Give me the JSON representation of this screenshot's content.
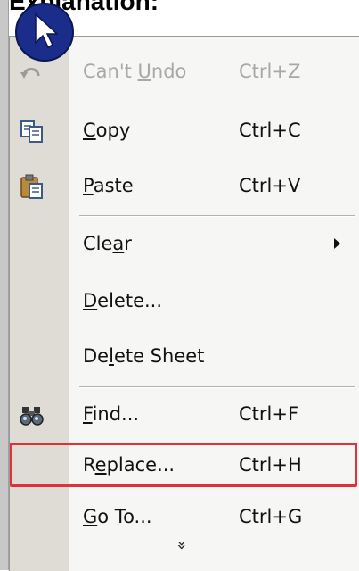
{
  "caption": "Explanation:",
  "menu": {
    "items": [
      {
        "label_pre": "Can't ",
        "label_u": "U",
        "label_post": "ndo",
        "shortcut": "Ctrl+Z",
        "disabled": true,
        "icon": "undo-icon"
      },
      {
        "label_pre": "",
        "label_u": "C",
        "label_post": "opy",
        "shortcut": "Ctrl+C",
        "icon": "copy-icon"
      },
      {
        "label_pre": "",
        "label_u": "P",
        "label_post": "aste",
        "shortcut": "Ctrl+V",
        "icon": "paste-icon"
      },
      {
        "label_pre": "Cle",
        "label_u": "a",
        "label_post": "r",
        "shortcut": "",
        "submenu": true
      },
      {
        "label_pre": "",
        "label_u": "D",
        "label_post": "elete...",
        "shortcut": ""
      },
      {
        "label_pre": "De",
        "label_u": "l",
        "label_post": "ete Sheet",
        "shortcut": ""
      },
      {
        "label_pre": "",
        "label_u": "F",
        "label_post": "ind...",
        "shortcut": "Ctrl+F",
        "icon": "binoculars-icon"
      },
      {
        "label_pre": "R",
        "label_u": "e",
        "label_post": "place...",
        "shortcut": "Ctrl+H",
        "highlighted": true
      },
      {
        "label_pre": "",
        "label_u": "G",
        "label_post": "o To...",
        "shortcut": "Ctrl+G"
      }
    ],
    "expand_glyph": "»"
  },
  "colors": {
    "highlight_border": "#e0303a",
    "gutter": "#dedcd4",
    "menu_bg": "#f6f6f4"
  }
}
